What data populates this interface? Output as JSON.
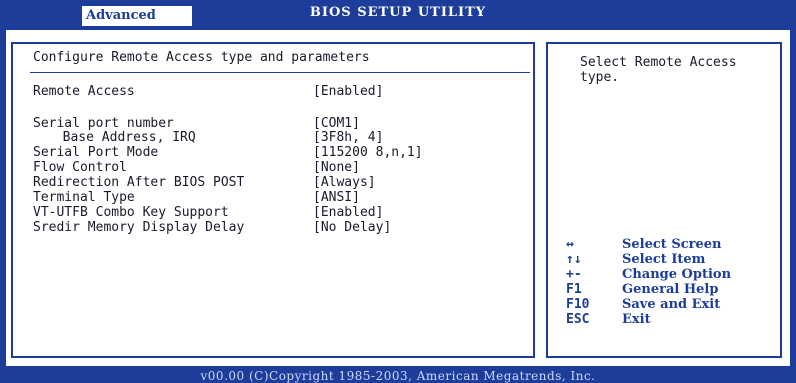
{
  "header": {
    "active_tab": "Advanced",
    "title": "BIOS SETUP UTILITY"
  },
  "main": {
    "heading": "Configure Remote Access type and parameters",
    "items": [
      {
        "label": "Remote Access",
        "value": "[Enabled]"
      },
      {
        "label": "Serial port number",
        "value": "[COM1]"
      },
      {
        "label": "  Base Address, IRQ",
        "value": "[3F8h, 4]"
      },
      {
        "label": "Serial Port Mode",
        "value": "[115200 8,n,1]"
      },
      {
        "label": "Flow Control",
        "value": "[None]"
      },
      {
        "label": "Redirection After BIOS POST",
        "value": "[Always]"
      },
      {
        "label": "Terminal Type",
        "value": "[ANSI]"
      },
      {
        "label": "VT-UTFB Combo Key Support",
        "value": "[Enabled]"
      },
      {
        "label": "Sredir Memory Display Delay",
        "value": "[No Delay]"
      }
    ]
  },
  "help": {
    "text": "Select Remote Access type.",
    "keys": [
      {
        "key": "↔",
        "desc": "Select Screen"
      },
      {
        "key": "↑↓",
        "desc": "Select Item"
      },
      {
        "key": "+-",
        "desc": "Change Option"
      },
      {
        "key": "F1",
        "desc": "General Help"
      },
      {
        "key": "F10",
        "desc": "Save and Exit"
      },
      {
        "key": "ESC",
        "desc": "Exit"
      }
    ]
  },
  "footer": {
    "text": "v00.00 (C)Copyright 1985-2003, American Megatrends, Inc."
  },
  "colors": {
    "bios_blue": "#1c3d9a",
    "panel_bg": "#ffffff",
    "text": "#1a1a2a"
  }
}
